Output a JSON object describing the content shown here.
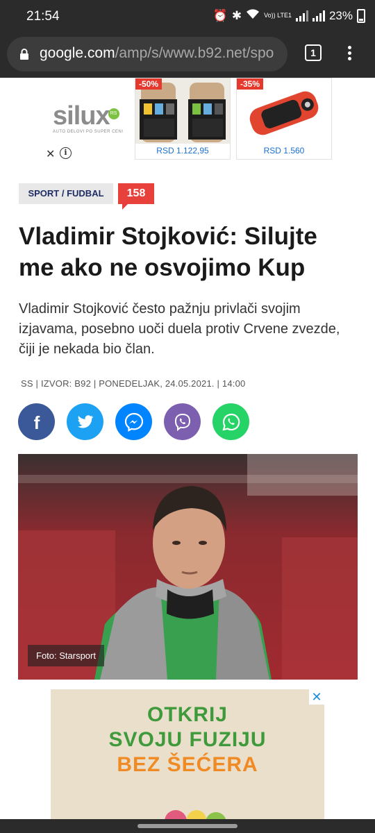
{
  "status_bar": {
    "time": "21:54",
    "network": "Vo)) LTE1",
    "battery": "23%"
  },
  "browser": {
    "url_host": "google.com",
    "url_path": "/amp/s/www.b92.net/spo",
    "tab_count": "1"
  },
  "top_ad": {
    "brand": "silux",
    "brand_badge": "RS",
    "tagline": "AUTO DELOVI PO SUPER CENI",
    "products": [
      {
        "discount": "-50%",
        "price": "RSD 1.122,95"
      },
      {
        "discount": "-35%",
        "price": "RSD 1.560"
      }
    ]
  },
  "article": {
    "category": "SPORT / FUDBAL",
    "comments": "158",
    "title": "Vladimir Stojković: Silujte me ako ne osvojimo Kup",
    "lead": "Vladimir Stojković često pažnju privlači svojim izjavama, posebno uoči duela protiv Crvene zvezde, čiji je nekada bio član.",
    "meta": "SS | IZVOR: B92 | PONEDELJAK, 24.05.2021. | 14:00",
    "photo_credit": "Foto: Starsport"
  },
  "share": [
    {
      "name": "facebook",
      "color": "#3b5998"
    },
    {
      "name": "twitter",
      "color": "#1da1f2"
    },
    {
      "name": "messenger",
      "color": "#0084ff"
    },
    {
      "name": "viber",
      "color": "#7d5fb0"
    },
    {
      "name": "whatsapp",
      "color": "#25d366"
    }
  ],
  "bottom_ad": {
    "line1": "OTKRIJ",
    "line2": "SVOJU FUZIJU",
    "line3": "BEZ ŠEĆERA"
  }
}
